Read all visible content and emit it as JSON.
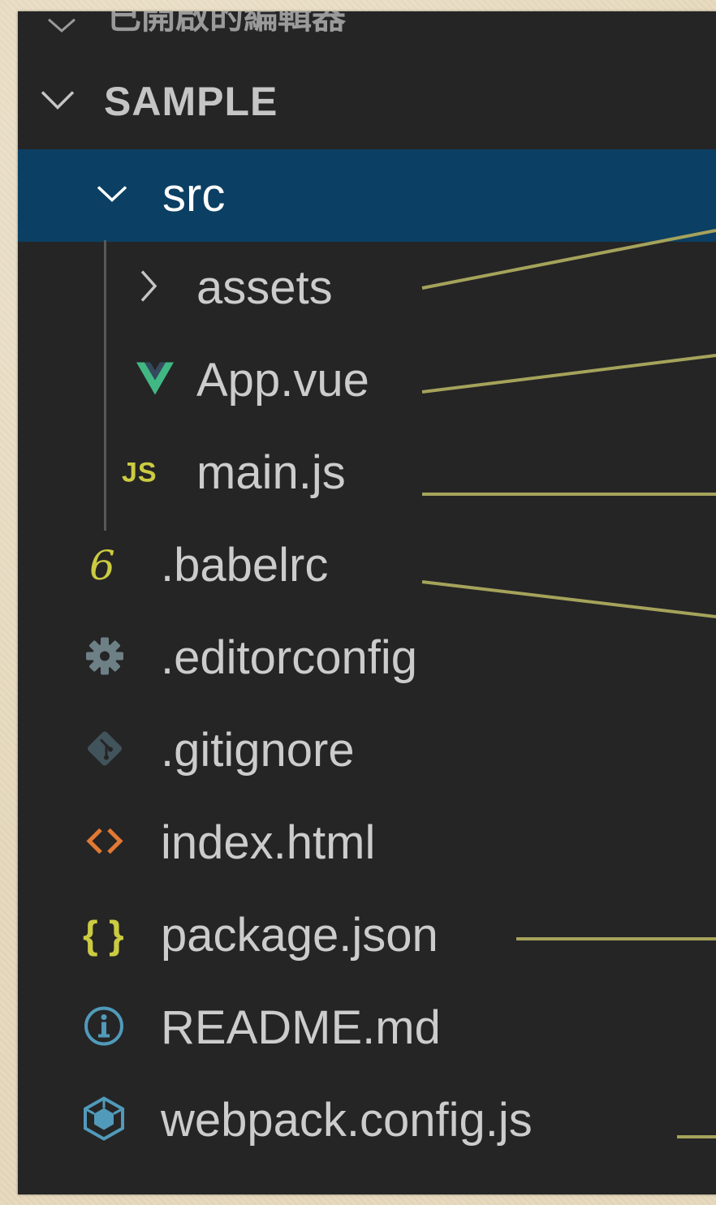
{
  "explorer": {
    "hidden_section_label": "已開啟的編輯器",
    "workspace_label": "SAMPLE",
    "items": [
      {
        "label": "src",
        "kind": "folder",
        "expanded": true,
        "selected": true,
        "icon": "chevron-down-icon"
      },
      {
        "label": "assets",
        "kind": "folder",
        "expanded": false,
        "icon": "chevron-right-icon"
      },
      {
        "label": "App.vue",
        "kind": "file",
        "icon": "vue-icon"
      },
      {
        "label": "main.js",
        "kind": "file",
        "icon": "javascript-icon",
        "icon_text": "JS"
      },
      {
        "label": ".babelrc",
        "kind": "file",
        "icon": "babel-icon",
        "icon_text": "6"
      },
      {
        "label": ".editorconfig",
        "kind": "file",
        "icon": "gear-icon"
      },
      {
        "label": ".gitignore",
        "kind": "file",
        "icon": "git-icon"
      },
      {
        "label": "index.html",
        "kind": "file",
        "icon": "html-icon",
        "icon_text": "<>"
      },
      {
        "label": "package.json",
        "kind": "file",
        "icon": "json-icon",
        "icon_text": "{ }"
      },
      {
        "label": "README.md",
        "kind": "file",
        "icon": "info-icon",
        "icon_text": "i"
      },
      {
        "label": "webpack.config.js",
        "kind": "file",
        "icon": "webpack-icon"
      }
    ]
  },
  "colors": {
    "panel_bg": "#252526",
    "selected_bg": "#0b3f63",
    "text": "#cccccc",
    "vue_green": "#41b883",
    "js_yellow": "#cbcb41",
    "html_orange": "#e37933",
    "json_yellow": "#cbcb41",
    "info_blue": "#519aba",
    "gear_gray": "#6d8086",
    "git_gray": "#41535b",
    "webpack_blue": "#519aba",
    "annotation_line": "#a5a35a"
  }
}
